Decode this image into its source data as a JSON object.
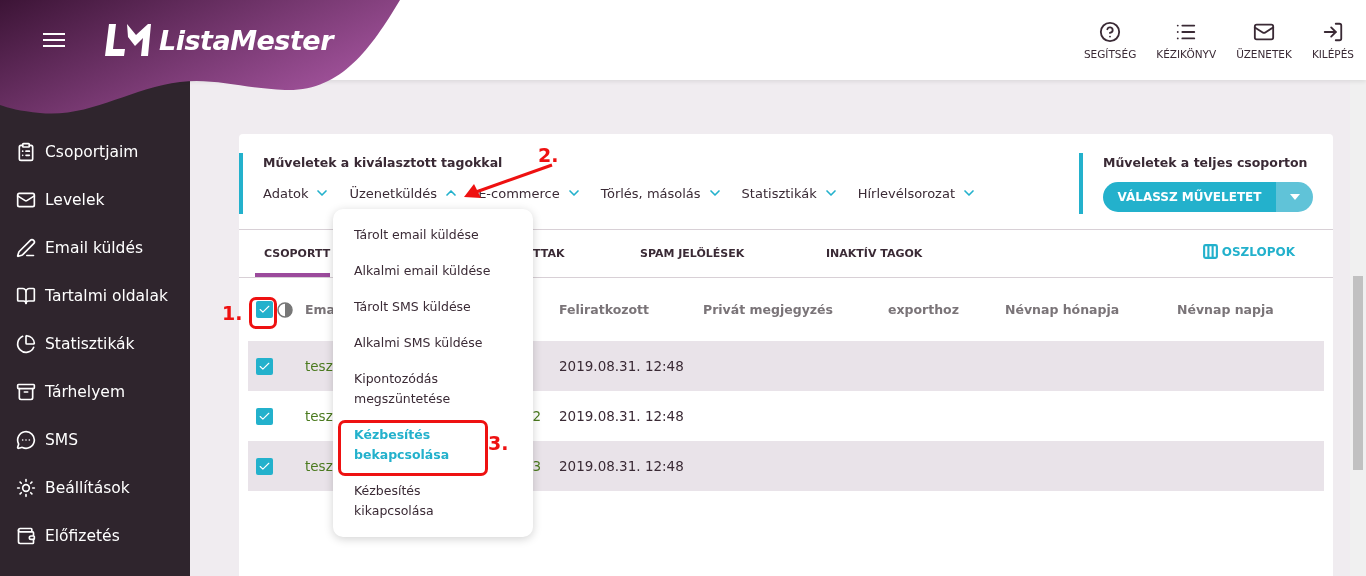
{
  "header": {
    "logo": "ListaMester",
    "actions": [
      {
        "label": "SEGÍTSÉG"
      },
      {
        "label": "KÉZIKÖNYV"
      },
      {
        "label": "ÜZENETEK"
      },
      {
        "label": "KILÉPÉS"
      }
    ]
  },
  "sidebar": {
    "items": [
      {
        "label": "Csoportjaim"
      },
      {
        "label": "Levelek"
      },
      {
        "label": "Email küldés"
      },
      {
        "label": "Tartalmi oldalak"
      },
      {
        "label": "Statisztikák"
      },
      {
        "label": "Tárhelyem"
      },
      {
        "label": "SMS"
      },
      {
        "label": "Beállítások"
      },
      {
        "label": "Előfizetés"
      }
    ]
  },
  "selected_actions": {
    "title": "Műveletek a kiválasztott tagokkal",
    "menus": [
      {
        "label": "Adatok",
        "expanded": false
      },
      {
        "label": "Üzenetküldés",
        "expanded": true
      },
      {
        "label": "E-commerce",
        "expanded": false
      },
      {
        "label": "Törlés, másolás",
        "expanded": false
      },
      {
        "label": "Statisztikák",
        "expanded": false
      },
      {
        "label": "Hírlevélsorozat",
        "expanded": false
      }
    ]
  },
  "group_actions": {
    "title": "Műveletek a teljes csoporton",
    "button": "VÁLASSZ MŰVELETET"
  },
  "tabs": [
    {
      "label": "CSOPORTT",
      "selected": true
    },
    {
      "label": "TTAK",
      "selected": false
    },
    {
      "label": "SPAM JELÖLÉSEK",
      "selected": false
    },
    {
      "label": "INAKTÍV TAGOK",
      "selected": false
    }
  ],
  "columns_button": "OSZLOPOK",
  "table": {
    "select_all_checked": true,
    "columns": [
      "Ema",
      "Feliratkozott",
      "Privát megjegyzés",
      "exporthoz",
      "Névnap hónapja",
      "Névnap napja"
    ],
    "rows": [
      {
        "checked": true,
        "email": "tesz",
        "subscribed": "2019.08.31. 12:48"
      },
      {
        "checked": true,
        "email": "tesz",
        "column_3": "2",
        "subscribed": "2019.08.31. 12:48"
      },
      {
        "checked": true,
        "email": "tesz",
        "column_3": "3",
        "subscribed": "2019.08.31. 12:48"
      }
    ]
  },
  "dropdown": {
    "items": [
      {
        "label": "Tárolt email küldése",
        "selected": false
      },
      {
        "label": "Alkalmi email küldése",
        "selected": false
      },
      {
        "label": "Tárolt SMS küldése",
        "selected": false
      },
      {
        "label": "Alkalmi SMS küldése",
        "selected": false
      },
      {
        "label": "Kipontozódás megszüntetése",
        "selected": false
      },
      {
        "label": "Kézbesítés bekapcsolása",
        "selected": true
      },
      {
        "label": "Kézbesítés kikapcsolása",
        "selected": false
      }
    ]
  },
  "annotations": [
    {
      "label": "1.",
      "kind": "box"
    },
    {
      "label": "2.",
      "kind": "arrow"
    },
    {
      "label": "3.",
      "kind": "box"
    }
  ]
}
